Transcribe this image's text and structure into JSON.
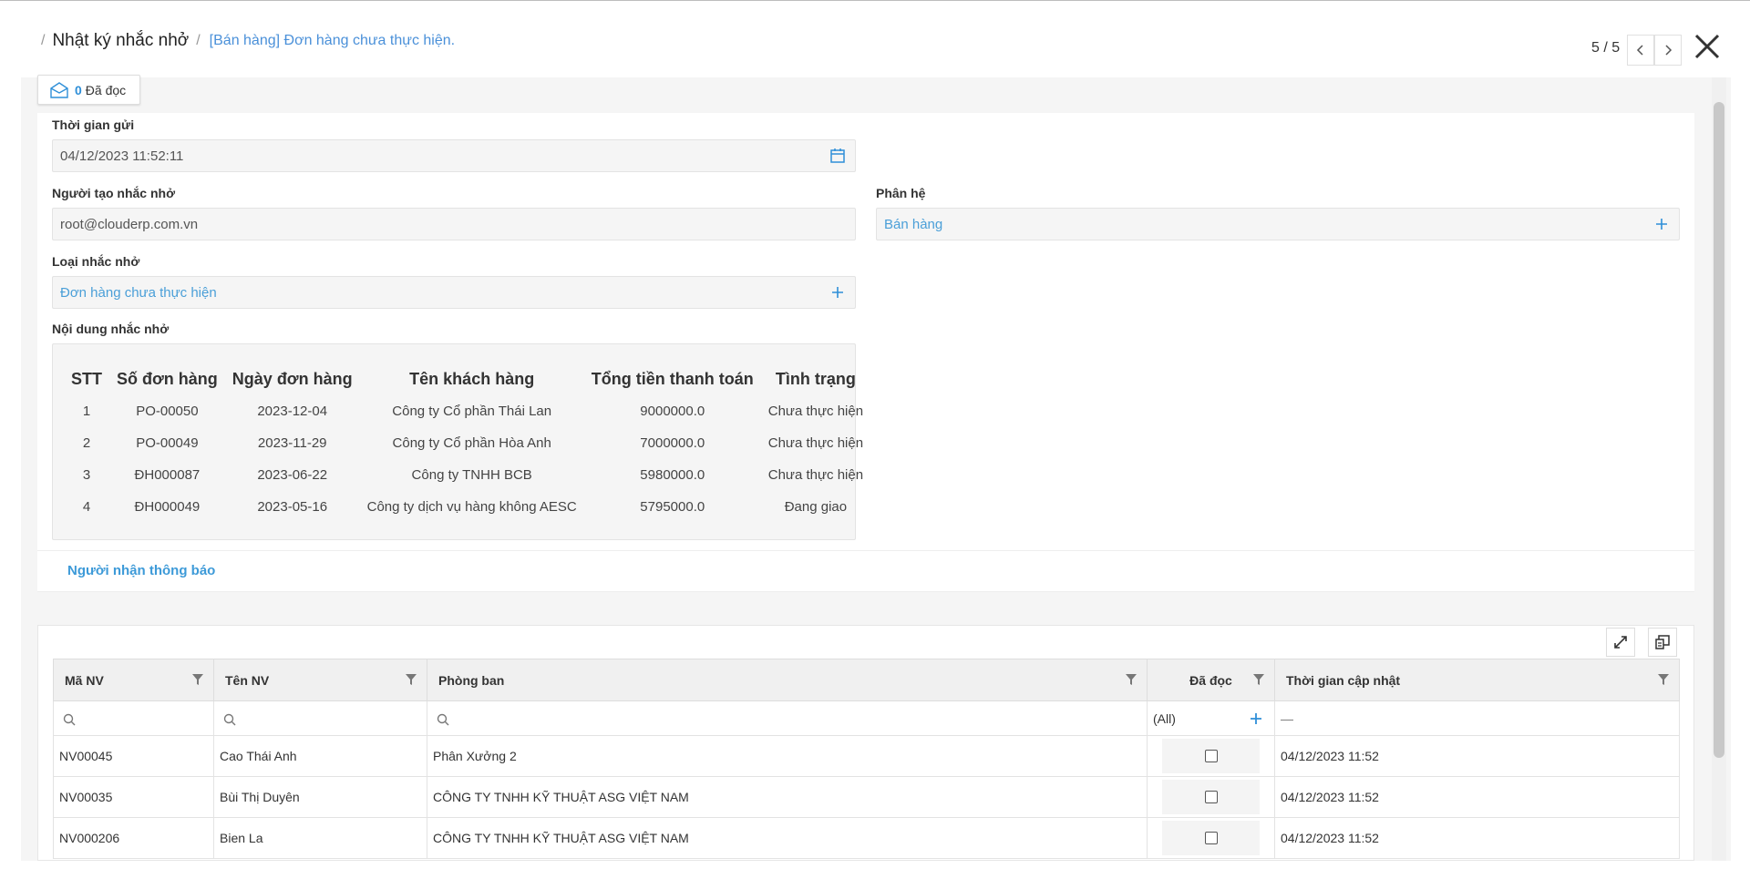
{
  "header": {
    "breadcrumb_sep1": "/",
    "title": "Nhật ký nhắc nhở",
    "breadcrumb_sep2": "/",
    "subtitle": "[Bán hàng] Đơn hàng chưa thực hiện.",
    "pager": "5 / 5"
  },
  "read_badge": {
    "count": "0",
    "label": "Đã đọc"
  },
  "form": {
    "sent_time_label": "Thời gian gửi",
    "sent_time_value": "04/12/2023 11:52:11",
    "creator_label": "Người tạo nhắc nhở",
    "creator_value": "root@clouderp.com.vn",
    "module_label": "Phân hệ",
    "module_value": "Bán hàng",
    "type_label": "Loại nhắc nhở",
    "type_value": "Đơn hàng chưa thực hiện",
    "content_label": "Nội dung nhắc nhở"
  },
  "reminder_table": {
    "headers": [
      "STT",
      "Số đơn hàng",
      "Ngày đơn hàng",
      "Tên khách hàng",
      "Tổng tiền thanh toán",
      "Tình trạng"
    ],
    "rows": [
      [
        "1",
        "PO-00050",
        "2023-12-04",
        "Công ty Cổ phần Thái Lan",
        "9000000.0",
        "Chưa thực hiện"
      ],
      [
        "2",
        "PO-00049",
        "2023-11-29",
        "Công ty Cổ phần Hòa Anh",
        "7000000.0",
        "Chưa thực hiện"
      ],
      [
        "3",
        "ĐH000087",
        "2023-06-22",
        "Công ty TNHH BCB",
        "5980000.0",
        "Chưa thực hiện"
      ],
      [
        "4",
        "ĐH000049",
        "2023-05-16",
        "Công ty dịch vụ hàng không AESC",
        "5795000.0",
        "Đang giao"
      ]
    ]
  },
  "recipients_tab": "Người nhận thông báo",
  "grid": {
    "columns": [
      "Mã NV",
      "Tên NV",
      "Phòng ban",
      "Đã đọc",
      "Thời gian cập nhật"
    ],
    "filter_all": "(All)",
    "filter_date": "—",
    "rows": [
      {
        "code": "NV00045",
        "name": "Cao Thái Anh",
        "dept": "Phân Xưởng 2",
        "updated": "04/12/2023 11:52"
      },
      {
        "code": "NV00035",
        "name": "Bùi Thị Duyên",
        "dept": "CÔNG TY TNHH KỸ THUẬT ASG VIỆT NAM",
        "updated": "04/12/2023 11:52"
      },
      {
        "code": "NV000206",
        "name": "Bien La",
        "dept": "CÔNG TY TNHH KỸ THUẬT ASG VIỆT NAM",
        "updated": "04/12/2023 11:52"
      }
    ]
  },
  "colors": {
    "accent": "#2f8fd8",
    "link": "#4a9fd8",
    "panel_bg": "#f5f5f5"
  }
}
